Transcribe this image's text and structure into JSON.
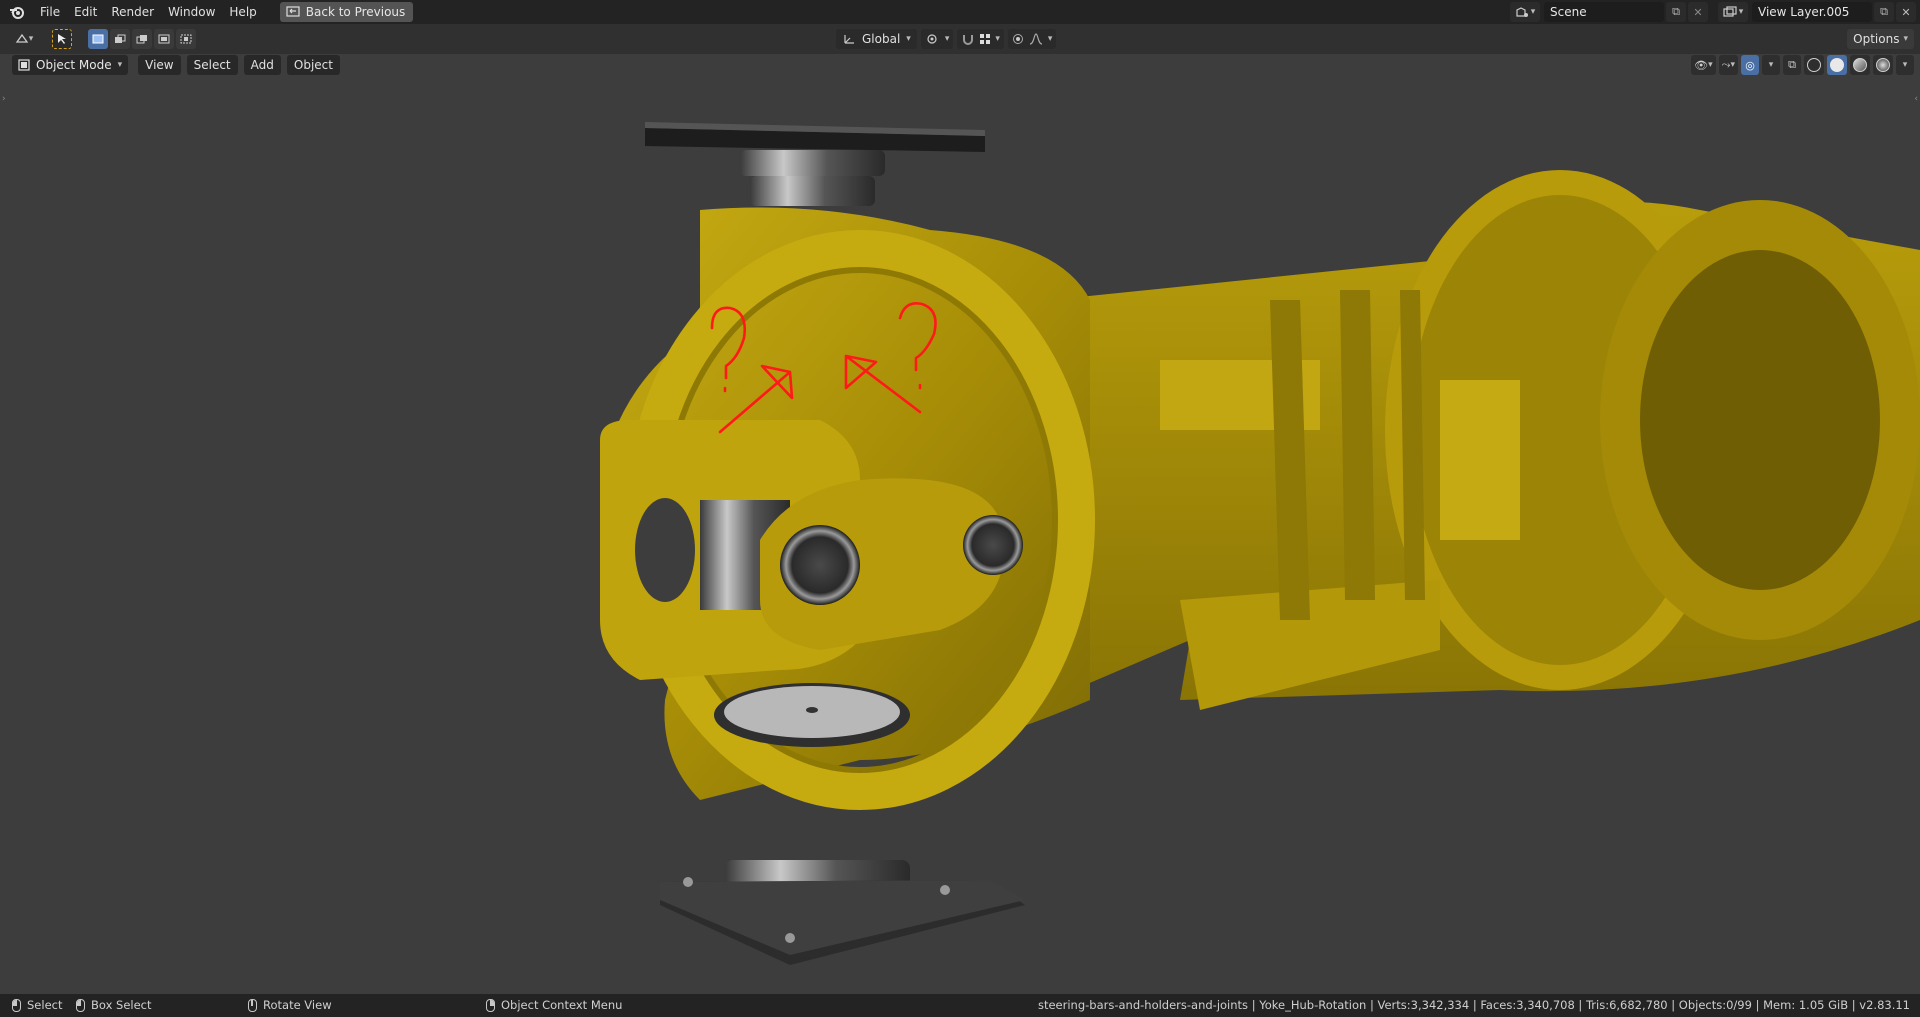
{
  "topbar": {
    "menus": [
      "File",
      "Edit",
      "Render",
      "Window",
      "Help"
    ],
    "back_button": "Back to Previous",
    "scene_name": "Scene",
    "view_layer": "View Layer.005"
  },
  "toolheader": {
    "orientation": "Global",
    "options_label": "Options"
  },
  "viewport_header": {
    "mode": "Object Mode",
    "menus": [
      "View",
      "Select",
      "Add",
      "Object"
    ]
  },
  "annotations": {
    "marks": [
      "?",
      "?"
    ],
    "color": "#ff1a1a"
  },
  "colors": {
    "model_yellow": "#b59a08",
    "background": "#3d3d3d",
    "accent_blue": "#4a6fa5"
  },
  "statusbar": {
    "left_action": "Select",
    "box_select": "Box Select",
    "rotate_view": "Rotate View",
    "context_menu": "Object Context Menu",
    "stats": "steering-bars-and-holders-and-joints | Yoke_Hub-Rotation | Verts:3,342,334 | Faces:3,340,708 | Tris:6,682,780 | Objects:0/99 | Mem: 1.05 GiB | v2.83.11"
  }
}
